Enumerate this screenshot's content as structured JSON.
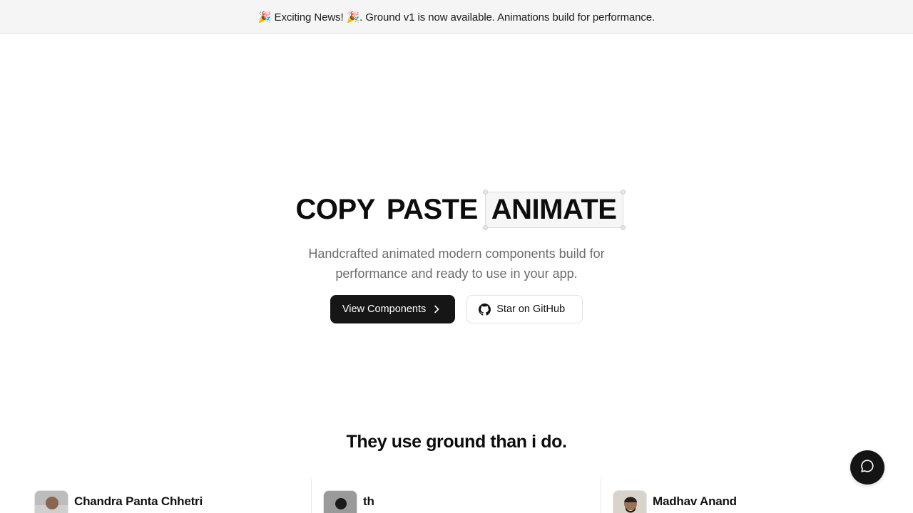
{
  "announcement": {
    "text": "🎉 Exciting News! 🎉. Ground v1 is now available. Animations build for performance."
  },
  "hero": {
    "headline_words": [
      "COPY",
      "PASTE",
      "ANIMATE"
    ],
    "subtitle": "Handcrafted animated modern components build for performance and ready to use in your app.",
    "primary_button": "View Components",
    "secondary_button": "Star on GitHub"
  },
  "testimonials": {
    "title": "They use ground than i do.",
    "people": [
      {
        "name": "Chandra Panta Chhetri"
      },
      {
        "name": "th"
      },
      {
        "name": "Madhav Anand"
      }
    ]
  },
  "icons": {
    "primary_button_icon": "chevron-right-icon",
    "secondary_button_icon": "github-icon",
    "chat_button_icon": "chat-bubble-icon"
  },
  "colors": {
    "announcement_bg": "#f5f5f5",
    "primary_button_bg": "#161616",
    "subtitle_text": "#6b6b6b",
    "chat_button_bg": "#141414"
  }
}
